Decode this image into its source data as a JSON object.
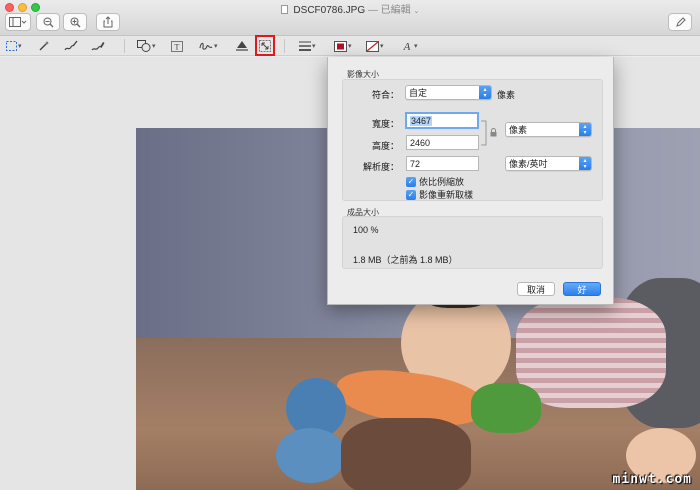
{
  "window": {
    "title": "DSCF0786.JPG",
    "status": "— 已編輯",
    "colors": {
      "close": "#fc615d",
      "minimize": "#fdbc40",
      "zoom": "#34c84a",
      "highlight": "#e0191e",
      "accent": "#2d80ea"
    }
  },
  "titlebar_buttons": [
    {
      "name": "sidebar-view-button",
      "icon": "sidebar-icon"
    },
    {
      "name": "zoom-out-button",
      "icon": "zoom-out-icon"
    },
    {
      "name": "zoom-in-button",
      "icon": "zoom-in-icon"
    },
    {
      "name": "share-button",
      "icon": "share-icon"
    },
    {
      "name": "markup-button",
      "icon": "pen-icon"
    }
  ],
  "toolbar": {
    "tools": [
      "rectangular-selection-icon",
      "instant-alpha-icon",
      "sketch-icon",
      "draw-icon",
      "shapes-icon",
      "text-icon",
      "sign-icon",
      "adjust-color-icon",
      "adjust-size-icon",
      "shape-style-icon",
      "border-color-icon",
      "fill-color-icon",
      "text-style-icon"
    ],
    "selected_tool": "adjust-size-icon"
  },
  "dialog": {
    "image_size_title": "影像大小",
    "fit_label": "符合：",
    "fit_value": "自定",
    "fit_unit": "像素",
    "width_label": "寬度：",
    "width_value": "3467",
    "height_label": "高度：",
    "height_value": "2460",
    "unit_value": "像素",
    "resolution_label": "解析度：",
    "resolution_value": "72",
    "resolution_unit": "像素/英吋",
    "scale_proportionally": "依比例縮放",
    "scale_proportionally_checked": true,
    "resample_image": "影像重新取樣",
    "resample_image_checked": true,
    "result_title": "成品大小",
    "result_percent": "100 %",
    "result_size": "1.8 MB（之前為 1.8 MB）",
    "cancel_label": "取消",
    "ok_label": "好"
  },
  "watermark": "minwt.com"
}
